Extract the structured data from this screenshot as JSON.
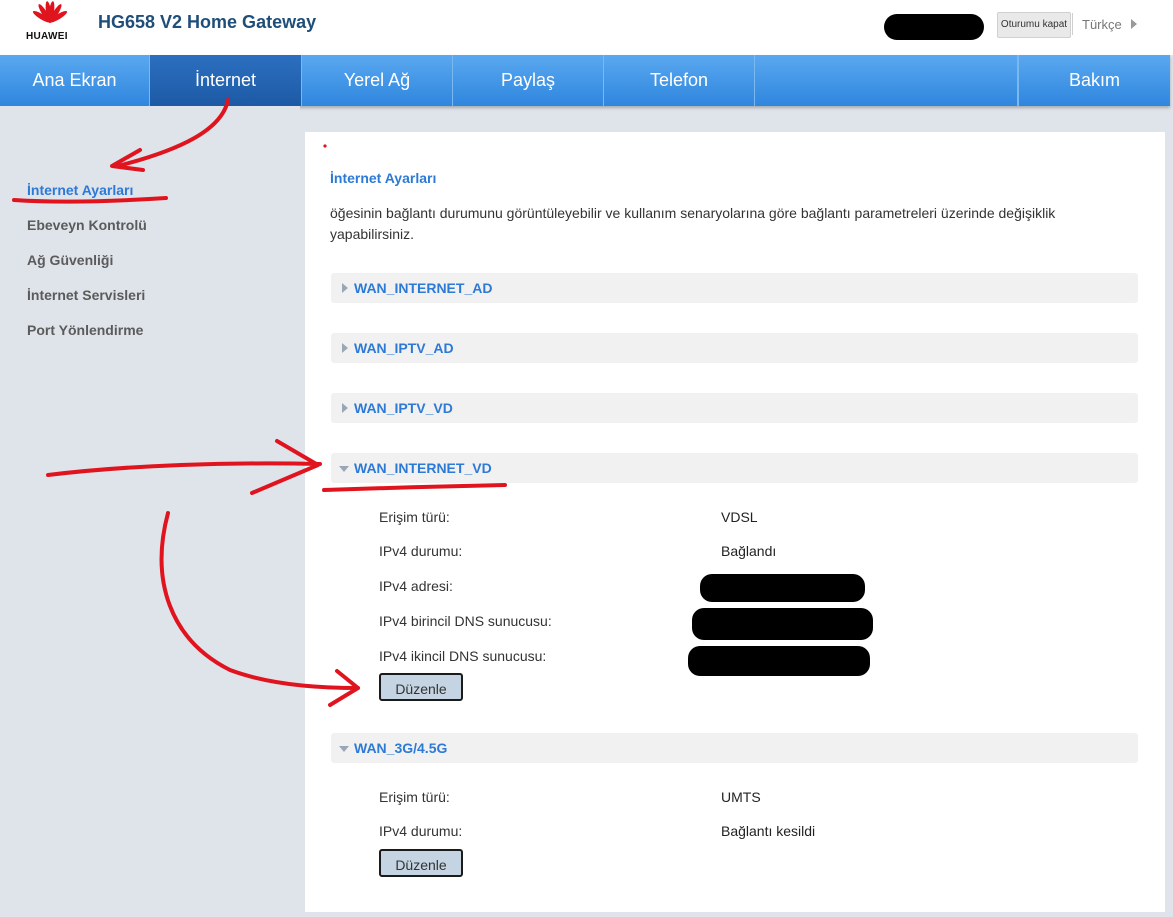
{
  "header": {
    "brand": "HUAWEI",
    "title": "HG658 V2 Home Gateway",
    "logout_label": "Oturumu kapat",
    "language": "Türkçe"
  },
  "nav": {
    "items": [
      "Ana Ekran",
      "İnternet",
      "Yerel Ağ",
      "Paylaş",
      "Telefon"
    ],
    "right_item": "Bakım",
    "active": "İnternet"
  },
  "sidebar": {
    "items": [
      "İnternet Ayarları",
      "Ebeveyn Kontrolü",
      "Ağ Güvenliği",
      "İnternet Servisleri",
      "Port Yönlendirme"
    ],
    "active": "İnternet Ayarları"
  },
  "main": {
    "title": "İnternet Ayarları",
    "description": "öğesinin bağlantı durumunu görüntüleyebilir ve kullanım senaryolarına göre bağlantı parametreleri üzerinde değişiklik yapabilirsiniz.",
    "panels": [
      {
        "name": "WAN_INTERNET_AD",
        "expanded": false
      },
      {
        "name": "WAN_IPTV_AD",
        "expanded": false
      },
      {
        "name": "WAN_IPTV_VD",
        "expanded": false
      },
      {
        "name": "WAN_INTERNET_VD",
        "expanded": true,
        "rows": [
          {
            "label": "Erişim türü:",
            "value": "VDSL"
          },
          {
            "label": "IPv4 durumu:",
            "value": "Bağlandı"
          },
          {
            "label": "IPv4 adresi:",
            "value": ""
          },
          {
            "label": "IPv4 birincil DNS sunucusu:",
            "value": ""
          },
          {
            "label": "IPv4 ikincil DNS sunucusu:",
            "value": ""
          }
        ],
        "button": "Düzenle"
      },
      {
        "name": "WAN_3G/4.5G",
        "expanded": true,
        "rows": [
          {
            "label": "Erişim türü:",
            "value": "UMTS"
          },
          {
            "label": "IPv4 durumu:",
            "value": "Bağlantı kesildi"
          }
        ],
        "button": "Düzenle"
      }
    ]
  },
  "colors": {
    "nav_blue": "#3a8fe3",
    "nav_active": "#2463b0",
    "link_blue": "#2d7ad6",
    "annotation_red": "#e0141e"
  }
}
